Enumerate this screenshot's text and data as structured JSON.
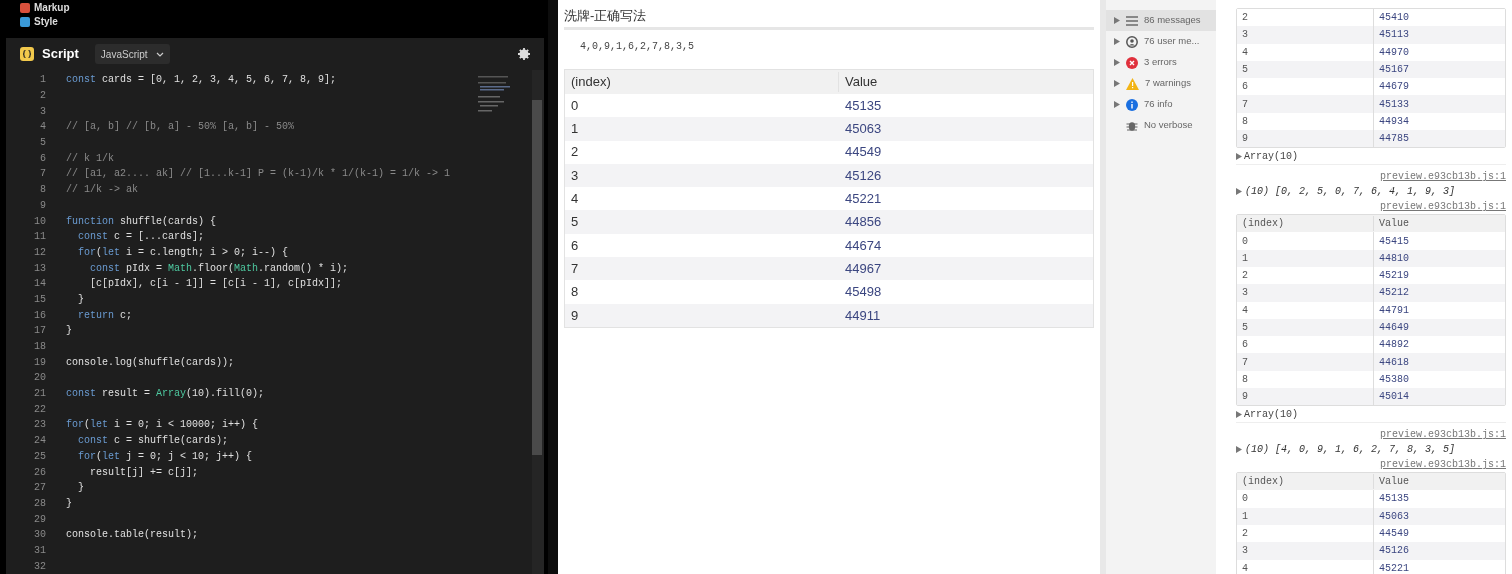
{
  "panels": [
    {
      "label": "Markup",
      "kind": "markup"
    },
    {
      "label": "Style",
      "kind": "style"
    }
  ],
  "editor": {
    "title": "Script",
    "language": "JavaScript",
    "lines": [
      {
        "number": "1",
        "segments": [
          {
            "kind": "keyword",
            "text": "const"
          },
          {
            "kind": "plain",
            "text": " cards = [0, 1, 2, 3, 4, 5, 6, 7, 8, 9];"
          }
        ]
      },
      {
        "number": "2"
      },
      {
        "number": "3"
      },
      {
        "number": "4",
        "segments": [
          {
            "kind": "comment",
            "text": "// [a, b] // [b, a] - 50% [a, b] - 50%"
          }
        ]
      },
      {
        "number": "5"
      },
      {
        "number": "6",
        "segments": [
          {
            "kind": "comment",
            "text": "// k 1/k"
          }
        ]
      },
      {
        "number": "7",
        "segments": [
          {
            "kind": "comment",
            "text": "// [a1, a2.... ak] // [1...k-1] P = (k-1)/k * 1/(k-1) = 1/k -> 1"
          }
        ]
      },
      {
        "number": "8",
        "segments": [
          {
            "kind": "comment",
            "text": "// 1/k -> ak"
          }
        ]
      },
      {
        "number": "9"
      },
      {
        "number": "10",
        "segments": [
          {
            "kind": "keyword",
            "text": "function"
          },
          {
            "kind": "plain",
            "text": " shuffle(cards) {"
          }
        ]
      },
      {
        "number": "11",
        "segments": [
          {
            "kind": "keyword",
            "text": "  const"
          },
          {
            "kind": "plain",
            "text": " c = [...cards];"
          }
        ]
      },
      {
        "number": "12",
        "segments": [
          {
            "kind": "keyword",
            "text": "  for"
          },
          {
            "kind": "plain",
            "text": "("
          },
          {
            "kind": "keyword",
            "text": "let"
          },
          {
            "kind": "plain",
            "text": " i = c.length; i > 0; i--) {"
          }
        ]
      },
      {
        "number": "13",
        "segments": [
          {
            "kind": "keyword",
            "text": "    const"
          },
          {
            "kind": "plain",
            "text": " pIdx = "
          },
          {
            "kind": "builtin",
            "text": "Math"
          },
          {
            "kind": "plain",
            "text": ".floor("
          },
          {
            "kind": "builtin",
            "text": "Math"
          },
          {
            "kind": "plain",
            "text": ".random() * i);"
          }
        ]
      },
      {
        "number": "14",
        "segments": [
          {
            "kind": "plain",
            "text": "    [c[pIdx], c[i - 1]] = [c[i - 1], c[pIdx]];"
          }
        ]
      },
      {
        "number": "15",
        "segments": [
          {
            "kind": "plain",
            "text": "  }"
          }
        ]
      },
      {
        "number": "16",
        "segments": [
          {
            "kind": "keyword",
            "text": "  return"
          },
          {
            "kind": "plain",
            "text": " c;"
          }
        ]
      },
      {
        "number": "17",
        "segments": [
          {
            "kind": "plain",
            "text": "}"
          }
        ]
      },
      {
        "number": "18"
      },
      {
        "number": "19",
        "segments": [
          {
            "kind": "plain",
            "text": "console.log(shuffle(cards));"
          }
        ]
      },
      {
        "number": "20"
      },
      {
        "number": "21",
        "segments": [
          {
            "kind": "keyword",
            "text": "const"
          },
          {
            "kind": "plain",
            "text": " result = "
          },
          {
            "kind": "builtin",
            "text": "Array"
          },
          {
            "kind": "plain",
            "text": "(10).fill(0);"
          }
        ]
      },
      {
        "number": "22"
      },
      {
        "number": "23",
        "segments": [
          {
            "kind": "keyword",
            "text": "for"
          },
          {
            "kind": "plain",
            "text": "("
          },
          {
            "kind": "keyword",
            "text": "let"
          },
          {
            "kind": "plain",
            "text": " i = 0; i < 10000; i++) {"
          }
        ]
      },
      {
        "number": "24",
        "segments": [
          {
            "kind": "keyword",
            "text": "  const"
          },
          {
            "kind": "plain",
            "text": " c = shuffle(cards);"
          }
        ]
      },
      {
        "number": "25",
        "segments": [
          {
            "kind": "keyword",
            "text": "  for"
          },
          {
            "kind": "plain",
            "text": "("
          },
          {
            "kind": "keyword",
            "text": "let"
          },
          {
            "kind": "plain",
            "text": " j = 0; j < 10; j++) {"
          }
        ]
      },
      {
        "number": "26",
        "segments": [
          {
            "kind": "plain",
            "text": "    result[j] += c[j];"
          }
        ]
      },
      {
        "number": "27",
        "segments": [
          {
            "kind": "plain",
            "text": "  }"
          }
        ]
      },
      {
        "number": "28",
        "segments": [
          {
            "kind": "plain",
            "text": "}"
          }
        ]
      },
      {
        "number": "29"
      },
      {
        "number": "30",
        "segments": [
          {
            "kind": "plain",
            "text": "console.table(result);"
          }
        ]
      },
      {
        "number": "31"
      },
      {
        "number": "32"
      }
    ]
  },
  "preview": {
    "title": "洗牌-正确写法",
    "output": "4,0,9,1,6,2,7,8,3,5",
    "table": {
      "columns": [
        "(index)",
        "Value"
      ],
      "rows": [
        [
          "0",
          "45135"
        ],
        [
          "1",
          "45063"
        ],
        [
          "2",
          "44549"
        ],
        [
          "3",
          "45126"
        ],
        [
          "4",
          "45221"
        ],
        [
          "5",
          "44856"
        ],
        [
          "6",
          "44674"
        ],
        [
          "7",
          "44967"
        ],
        [
          "8",
          "45498"
        ],
        [
          "9",
          "44911"
        ]
      ]
    }
  },
  "console_sidebar": [
    {
      "label": "86 messages",
      "kind": "messages",
      "selected": true
    },
    {
      "label": "76 user me...",
      "kind": "user",
      "selected": false
    },
    {
      "label": "3 errors",
      "kind": "errors",
      "selected": false
    },
    {
      "label": "7 warnings",
      "kind": "warnings",
      "selected": false
    },
    {
      "label": "76 info",
      "kind": "info",
      "selected": false
    },
    {
      "label": "No verbose",
      "kind": "verbose",
      "selected": false
    }
  ],
  "console": [
    {
      "kind": "table",
      "rows": [
        [
          "2",
          "45410"
        ],
        [
          "3",
          "45113"
        ],
        [
          "4",
          "44970"
        ],
        [
          "5",
          "45167"
        ],
        [
          "6",
          "44679"
        ],
        [
          "7",
          "45133"
        ],
        [
          "8",
          "44934"
        ],
        [
          "9",
          "44785"
        ]
      ]
    },
    {
      "kind": "expander",
      "text": "Array(10)"
    },
    {
      "kind": "source",
      "text": "preview.e93cb13b.js:1"
    },
    {
      "kind": "log",
      "text": "(10) [0, 2, 5, 0, 7, 6, 4, 1, 9, 3]"
    },
    {
      "kind": "source",
      "text": "preview.e93cb13b.js:1"
    },
    {
      "kind": "table",
      "columns": [
        "(index)",
        "Value"
      ],
      "rows": [
        [
          "0",
          "45415"
        ],
        [
          "1",
          "44810"
        ],
        [
          "2",
          "45219"
        ],
        [
          "3",
          "45212"
        ],
        [
          "4",
          "44791"
        ],
        [
          "5",
          "44649"
        ],
        [
          "6",
          "44892"
        ],
        [
          "7",
          "44618"
        ],
        [
          "8",
          "45380"
        ],
        [
          "9",
          "45014"
        ]
      ]
    },
    {
      "kind": "expander",
      "text": "Array(10)"
    },
    {
      "kind": "source",
      "text": "preview.e93cb13b.js:1"
    },
    {
      "kind": "log",
      "text": "(10) [4, 0, 9, 1, 6, 2, 7, 8, 3, 5]"
    },
    {
      "kind": "source",
      "text": "preview.e93cb13b.js:1"
    },
    {
      "kind": "table",
      "columns": [
        "(index)",
        "Value"
      ],
      "rows": [
        [
          "0",
          "45135"
        ],
        [
          "1",
          "45063"
        ],
        [
          "2",
          "44549"
        ],
        [
          "3",
          "45126"
        ],
        [
          "4",
          "45221"
        ]
      ]
    }
  ]
}
